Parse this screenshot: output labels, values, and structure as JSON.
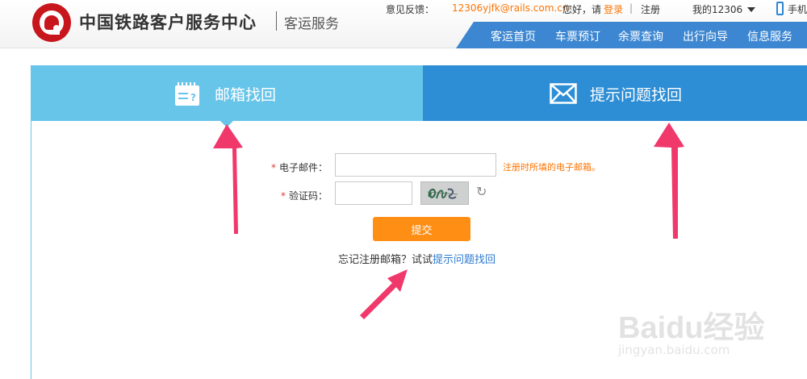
{
  "header": {
    "brand": "中国铁路客户服务中心",
    "subtitle": "客运服务",
    "feedback_label": "意见反馈：",
    "feedback_email": "12306yjfk@rails.com.cn",
    "greeting": "您好，请",
    "login": "登录",
    "divider": "|",
    "register": "注册",
    "my12306": "我的12306",
    "mobile": "手机"
  },
  "nav": {
    "items": [
      "客运首页",
      "车票预订",
      "余票查询",
      "出行向导",
      "信息服务"
    ]
  },
  "tabs": [
    {
      "label": "邮箱找回",
      "icon": "calendar-form-icon"
    },
    {
      "label": "提示问题找回",
      "icon": "envelope-icon"
    }
  ],
  "form": {
    "required_mark": "*",
    "email_label": "电子邮件：",
    "email_value": "",
    "email_hint": "注册时所填的电子邮箱。",
    "code_label": "验证码：",
    "code_value": "",
    "submit": "提交",
    "forgot_prefix": "忘记注册邮箱？试试",
    "forgot_link": "提示问题找回"
  },
  "watermark": {
    "brand": "Baidu经验",
    "url": "jingyan.baidu.com"
  },
  "colors": {
    "active_tab": "#68c5ea",
    "inactive_tab": "#2d8ed5",
    "nav": "#3d87d2",
    "submit": "#ff8e15",
    "hint": "#fb7403",
    "arrow": "#f0386b"
  }
}
